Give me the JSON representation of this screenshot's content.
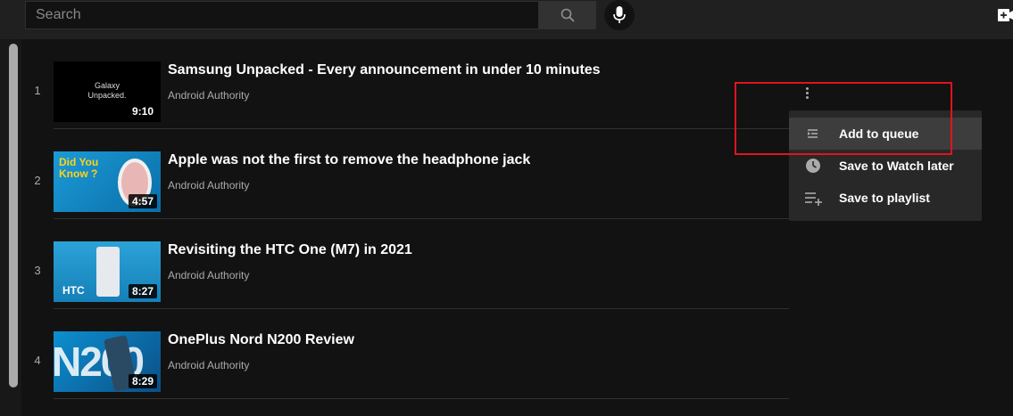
{
  "search": {
    "placeholder": "Search"
  },
  "playlist": {
    "items": [
      {
        "index": "1",
        "title": "Samsung Unpacked - Every announcement in under 10 minutes",
        "channel": "Android Authority",
        "duration": "9:10",
        "thumb_text": "Galaxy Unpacked."
      },
      {
        "index": "2",
        "title": "Apple was not the first to remove the headphone jack",
        "channel": "Android Authority",
        "duration": "4:57",
        "thumb_text": "Did You Know ?"
      },
      {
        "index": "3",
        "title": "Revisiting the HTC One (M7) in 2021",
        "channel": "Android Authority",
        "duration": "8:27",
        "thumb_text": "HTC"
      },
      {
        "index": "4",
        "title": "OnePlus Nord N200 Review",
        "channel": "Android Authority",
        "duration": "8:29",
        "thumb_text": "N200"
      }
    ]
  },
  "menu": {
    "items": [
      {
        "label": "Add to queue",
        "icon": "queue-icon"
      },
      {
        "label": "Save to Watch later",
        "icon": "clock-icon"
      },
      {
        "label": "Save to playlist",
        "icon": "playlist-add-icon"
      }
    ]
  },
  "colors": {
    "background": "#121212",
    "topbar": "#202020",
    "menu": "#282828",
    "highlight": "#e0141e",
    "secondary_text": "#aaaaaa"
  }
}
